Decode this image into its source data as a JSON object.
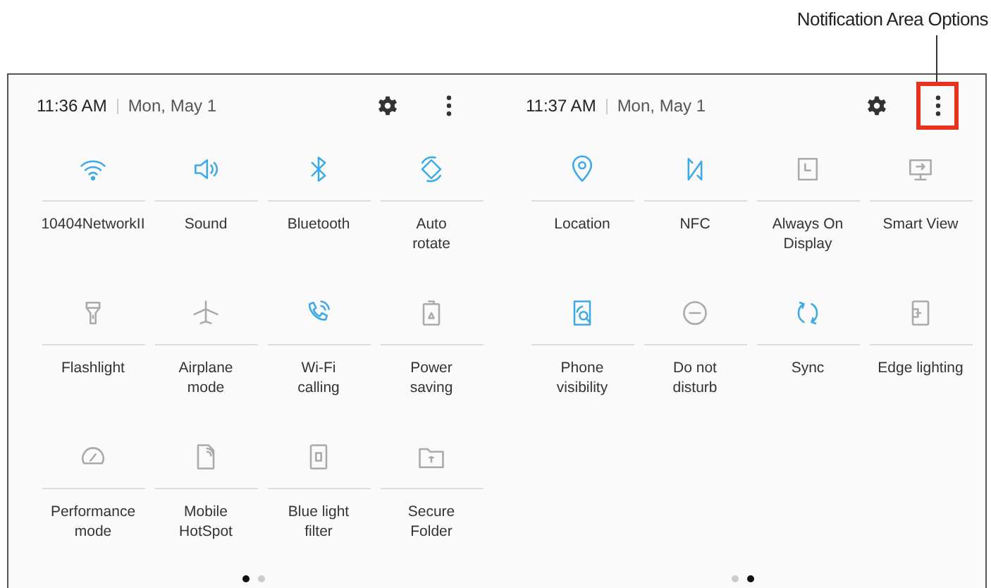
{
  "annotation": {
    "label": "Notification Area Options"
  },
  "panels": [
    {
      "time": "11:36 AM",
      "date": "Mon, May 1",
      "options_highlighted": false,
      "tiles": [
        {
          "label": "10404NetworkII",
          "on": true
        },
        {
          "label": "Sound",
          "on": true
        },
        {
          "label": "Bluetooth",
          "on": true
        },
        {
          "label": "Auto\nrotate",
          "on": true
        },
        {
          "label": "Flashlight",
          "on": false
        },
        {
          "label": "Airplane\nmode",
          "on": false
        },
        {
          "label": "Wi-Fi\ncalling",
          "on": true
        },
        {
          "label": "Power\nsaving",
          "on": false
        },
        {
          "label": "Performance\nmode",
          "on": false
        },
        {
          "label": "Mobile\nHotSpot",
          "on": false
        },
        {
          "label": "Blue light\nfilter",
          "on": false
        },
        {
          "label": "Secure\nFolder",
          "on": false
        }
      ],
      "pages": [
        {
          "selected": true
        },
        {
          "selected": false
        }
      ]
    },
    {
      "time": "11:37 AM",
      "date": "Mon, May 1",
      "options_highlighted": true,
      "tiles": [
        {
          "label": "Location",
          "on": true
        },
        {
          "label": "NFC",
          "on": true
        },
        {
          "label": "Always On\nDisplay",
          "on": false
        },
        {
          "label": "Smart View",
          "on": false
        },
        {
          "label": "Phone\nvisibility",
          "on": true
        },
        {
          "label": "Do not\ndisturb",
          "on": false
        },
        {
          "label": "Sync",
          "on": true
        },
        {
          "label": "Edge lighting",
          "on": false
        }
      ],
      "pages": [
        {
          "selected": false
        },
        {
          "selected": true
        }
      ]
    }
  ]
}
